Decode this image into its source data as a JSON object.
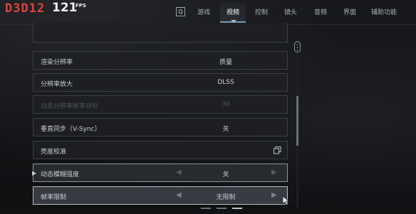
{
  "header": {
    "api": "D3D12",
    "fps_value": "121",
    "fps_unit": "FPS",
    "q_key": "Q",
    "tabs": [
      {
        "label": "游戏",
        "active": false
      },
      {
        "label": "视频",
        "active": true
      },
      {
        "label": "控制",
        "active": false
      },
      {
        "label": "镜头",
        "active": false
      },
      {
        "label": "音频",
        "active": false
      },
      {
        "label": "界面",
        "active": false
      },
      {
        "label": "辅助功能",
        "active": false
      }
    ]
  },
  "settings": [
    {
      "label": "渲染分辨率",
      "value": "质量",
      "state": "normal"
    },
    {
      "label": "分辨率放大",
      "value": "DLSS",
      "state": "normal"
    },
    {
      "label": "动态分辨率帧率目标",
      "value": "30",
      "state": "disabled"
    },
    {
      "label": "垂直同步（V-Sync）",
      "value": "关",
      "state": "normal"
    },
    {
      "label": "亮度校准",
      "value": "",
      "icon": "copy-icon",
      "state": "normal"
    },
    {
      "label": "动态模糊强度",
      "value": "关",
      "state": "highlighted",
      "arrows": true
    },
    {
      "label": "帧率限制",
      "value": "无限制",
      "state": "focused",
      "arrows": true
    }
  ],
  "colors": {
    "api": "#d9453e",
    "tab_accent": "#7a9bb6"
  }
}
